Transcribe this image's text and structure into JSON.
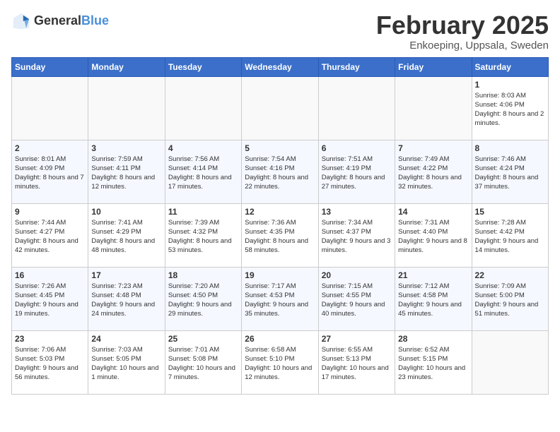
{
  "logo": {
    "general": "General",
    "blue": "Blue"
  },
  "title": "February 2025",
  "subtitle": "Enkoeping, Uppsala, Sweden",
  "days_of_week": [
    "Sunday",
    "Monday",
    "Tuesday",
    "Wednesday",
    "Thursday",
    "Friday",
    "Saturday"
  ],
  "weeks": [
    [
      {
        "num": "",
        "detail": ""
      },
      {
        "num": "",
        "detail": ""
      },
      {
        "num": "",
        "detail": ""
      },
      {
        "num": "",
        "detail": ""
      },
      {
        "num": "",
        "detail": ""
      },
      {
        "num": "",
        "detail": ""
      },
      {
        "num": "1",
        "detail": "Sunrise: 8:03 AM\nSunset: 4:06 PM\nDaylight: 8 hours and 2 minutes."
      }
    ],
    [
      {
        "num": "2",
        "detail": "Sunrise: 8:01 AM\nSunset: 4:09 PM\nDaylight: 8 hours and 7 minutes."
      },
      {
        "num": "3",
        "detail": "Sunrise: 7:59 AM\nSunset: 4:11 PM\nDaylight: 8 hours and 12 minutes."
      },
      {
        "num": "4",
        "detail": "Sunrise: 7:56 AM\nSunset: 4:14 PM\nDaylight: 8 hours and 17 minutes."
      },
      {
        "num": "5",
        "detail": "Sunrise: 7:54 AM\nSunset: 4:16 PM\nDaylight: 8 hours and 22 minutes."
      },
      {
        "num": "6",
        "detail": "Sunrise: 7:51 AM\nSunset: 4:19 PM\nDaylight: 8 hours and 27 minutes."
      },
      {
        "num": "7",
        "detail": "Sunrise: 7:49 AM\nSunset: 4:22 PM\nDaylight: 8 hours and 32 minutes."
      },
      {
        "num": "8",
        "detail": "Sunrise: 7:46 AM\nSunset: 4:24 PM\nDaylight: 8 hours and 37 minutes."
      }
    ],
    [
      {
        "num": "9",
        "detail": "Sunrise: 7:44 AM\nSunset: 4:27 PM\nDaylight: 8 hours and 42 minutes."
      },
      {
        "num": "10",
        "detail": "Sunrise: 7:41 AM\nSunset: 4:29 PM\nDaylight: 8 hours and 48 minutes."
      },
      {
        "num": "11",
        "detail": "Sunrise: 7:39 AM\nSunset: 4:32 PM\nDaylight: 8 hours and 53 minutes."
      },
      {
        "num": "12",
        "detail": "Sunrise: 7:36 AM\nSunset: 4:35 PM\nDaylight: 8 hours and 58 minutes."
      },
      {
        "num": "13",
        "detail": "Sunrise: 7:34 AM\nSunset: 4:37 PM\nDaylight: 9 hours and 3 minutes."
      },
      {
        "num": "14",
        "detail": "Sunrise: 7:31 AM\nSunset: 4:40 PM\nDaylight: 9 hours and 8 minutes."
      },
      {
        "num": "15",
        "detail": "Sunrise: 7:28 AM\nSunset: 4:42 PM\nDaylight: 9 hours and 14 minutes."
      }
    ],
    [
      {
        "num": "16",
        "detail": "Sunrise: 7:26 AM\nSunset: 4:45 PM\nDaylight: 9 hours and 19 minutes."
      },
      {
        "num": "17",
        "detail": "Sunrise: 7:23 AM\nSunset: 4:48 PM\nDaylight: 9 hours and 24 minutes."
      },
      {
        "num": "18",
        "detail": "Sunrise: 7:20 AM\nSunset: 4:50 PM\nDaylight: 9 hours and 29 minutes."
      },
      {
        "num": "19",
        "detail": "Sunrise: 7:17 AM\nSunset: 4:53 PM\nDaylight: 9 hours and 35 minutes."
      },
      {
        "num": "20",
        "detail": "Sunrise: 7:15 AM\nSunset: 4:55 PM\nDaylight: 9 hours and 40 minutes."
      },
      {
        "num": "21",
        "detail": "Sunrise: 7:12 AM\nSunset: 4:58 PM\nDaylight: 9 hours and 45 minutes."
      },
      {
        "num": "22",
        "detail": "Sunrise: 7:09 AM\nSunset: 5:00 PM\nDaylight: 9 hours and 51 minutes."
      }
    ],
    [
      {
        "num": "23",
        "detail": "Sunrise: 7:06 AM\nSunset: 5:03 PM\nDaylight: 9 hours and 56 minutes."
      },
      {
        "num": "24",
        "detail": "Sunrise: 7:03 AM\nSunset: 5:05 PM\nDaylight: 10 hours and 1 minute."
      },
      {
        "num": "25",
        "detail": "Sunrise: 7:01 AM\nSunset: 5:08 PM\nDaylight: 10 hours and 7 minutes."
      },
      {
        "num": "26",
        "detail": "Sunrise: 6:58 AM\nSunset: 5:10 PM\nDaylight: 10 hours and 12 minutes."
      },
      {
        "num": "27",
        "detail": "Sunrise: 6:55 AM\nSunset: 5:13 PM\nDaylight: 10 hours and 17 minutes."
      },
      {
        "num": "28",
        "detail": "Sunrise: 6:52 AM\nSunset: 5:15 PM\nDaylight: 10 hours and 23 minutes."
      },
      {
        "num": "",
        "detail": ""
      }
    ]
  ]
}
